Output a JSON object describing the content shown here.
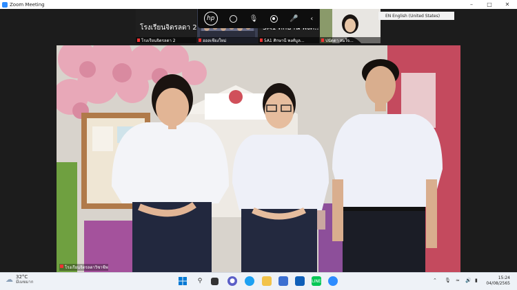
{
  "window": {
    "title": "Zoom Meeting",
    "minimize_glyph": "–",
    "maximize_glyph": "□",
    "close_glyph": "✕"
  },
  "hp_toolbar": {
    "logo_text": "hp"
  },
  "thumbnails": [
    {
      "title": "โรงเรียนจิตรลดา 2",
      "name": "โรงเรียนจิตรลดา 2"
    },
    {
      "title": "",
      "name": "ฮอลเชียงใหม่"
    },
    {
      "title": "5A1 ศิกษานี พงศ์...",
      "name": "5A1 ศิกษานี พงศ์มูล..."
    },
    {
      "title": "",
      "name": "ปนัดดา สมใจ..."
    }
  ],
  "language_badge": "EN English (United States)",
  "main_video": {
    "caption": "โรงเรียนจิตรลดาวิชาชีพ"
  },
  "taskbar": {
    "temperature": "32°C",
    "condition": "มีเมฆมาก",
    "time": "15:24",
    "date": "04/08/2565",
    "colors": {
      "windows": "#0078d4",
      "zoom": "#2d8cff",
      "line": "#06c755",
      "edge": "#1da1f2"
    }
  }
}
